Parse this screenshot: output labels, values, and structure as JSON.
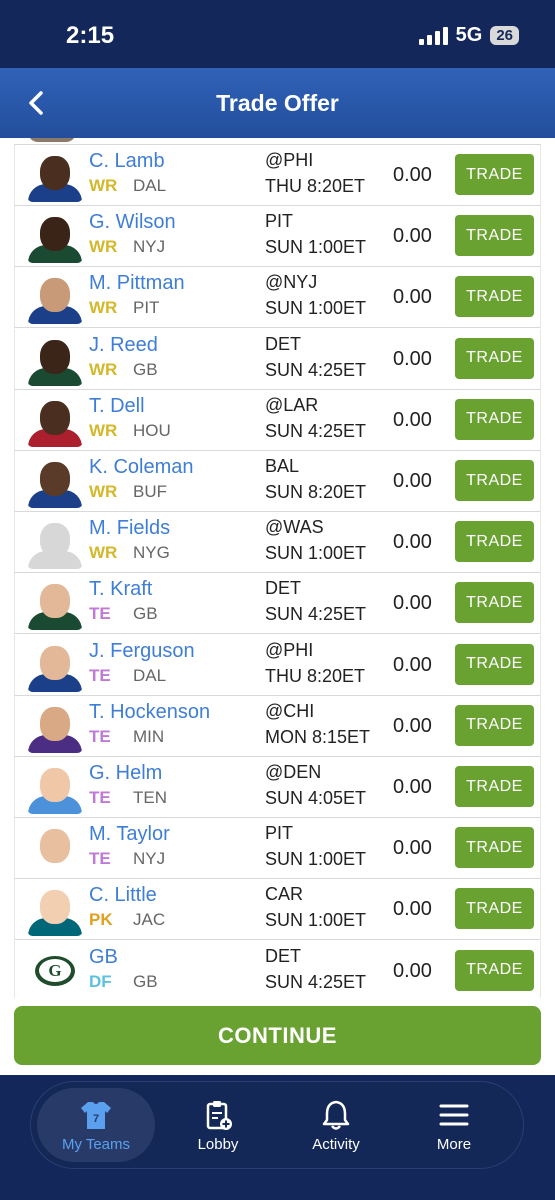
{
  "status_bar": {
    "time": "2:15",
    "network": "5G",
    "battery": "26"
  },
  "header": {
    "title": "Trade Offer"
  },
  "players": [
    {
      "name": "C. Lamb",
      "pos": "WR",
      "team": "DAL",
      "opp": "@PHI",
      "time": "THU 8:20ET",
      "pts": "0.00",
      "action": "TRADE"
    },
    {
      "name": "G. Wilson",
      "pos": "WR",
      "team": "NYJ",
      "opp": "PIT",
      "time": "SUN 1:00ET",
      "pts": "0.00",
      "action": "TRADE"
    },
    {
      "name": "M. Pittman",
      "pos": "WR",
      "team": "PIT",
      "opp": "@NYJ",
      "time": "SUN 1:00ET",
      "pts": "0.00",
      "action": "TRADE"
    },
    {
      "name": "J. Reed",
      "pos": "WR",
      "team": "GB",
      "opp": "DET",
      "time": "SUN 4:25ET",
      "pts": "0.00",
      "action": "TRADE"
    },
    {
      "name": "T. Dell",
      "pos": "WR",
      "team": "HOU",
      "opp": "@LAR",
      "time": "SUN 4:25ET",
      "pts": "0.00",
      "action": "TRADE"
    },
    {
      "name": "K. Coleman",
      "pos": "WR",
      "team": "BUF",
      "opp": "BAL",
      "time": "SUN 8:20ET",
      "pts": "0.00",
      "action": "TRADE"
    },
    {
      "name": "M. Fields",
      "pos": "WR",
      "team": "NYG",
      "opp": "@WAS",
      "time": "SUN 1:00ET",
      "pts": "0.00",
      "action": "TRADE"
    },
    {
      "name": "T. Kraft",
      "pos": "TE",
      "team": "GB",
      "opp": "DET",
      "time": "SUN 4:25ET",
      "pts": "0.00",
      "action": "TRADE"
    },
    {
      "name": "J. Ferguson",
      "pos": "TE",
      "team": "DAL",
      "opp": "@PHI",
      "time": "THU 8:20ET",
      "pts": "0.00",
      "action": "TRADE"
    },
    {
      "name": "T. Hockenson",
      "pos": "TE",
      "team": "MIN",
      "opp": "@CHI",
      "time": "MON 8:15ET",
      "pts": "0.00",
      "action": "TRADE"
    },
    {
      "name": "G. Helm",
      "pos": "TE",
      "team": "TEN",
      "opp": "@DEN",
      "time": "SUN 4:05ET",
      "pts": "0.00",
      "action": "TRADE"
    },
    {
      "name": "M. Taylor",
      "pos": "TE",
      "team": "NYJ",
      "opp": "PIT",
      "time": "SUN 1:00ET",
      "pts": "0.00",
      "action": "TRADE"
    },
    {
      "name": "C. Little",
      "pos": "PK",
      "team": "JAC",
      "opp": "CAR",
      "time": "SUN 1:00ET",
      "pts": "0.00",
      "action": "TRADE"
    },
    {
      "name": "GB",
      "pos": "DF",
      "team": "GB",
      "opp": "DET",
      "time": "SUN 4:25ET",
      "pts": "0.00",
      "action": "TRADE"
    }
  ],
  "position_colors": {
    "WR": "#d4b82a",
    "TE": "#c07ad6",
    "PK": "#e0a020",
    "DF": "#5cc0e0"
  },
  "continue_label": "CONTINUE",
  "tabs": [
    {
      "label": "My Teams",
      "icon": "jersey-icon",
      "badge": "7",
      "active": true
    },
    {
      "label": "Lobby",
      "icon": "clipboard-add-icon",
      "active": false
    },
    {
      "label": "Activity",
      "icon": "bell-icon",
      "active": false
    },
    {
      "label": "More",
      "icon": "menu-icon",
      "active": false
    }
  ]
}
